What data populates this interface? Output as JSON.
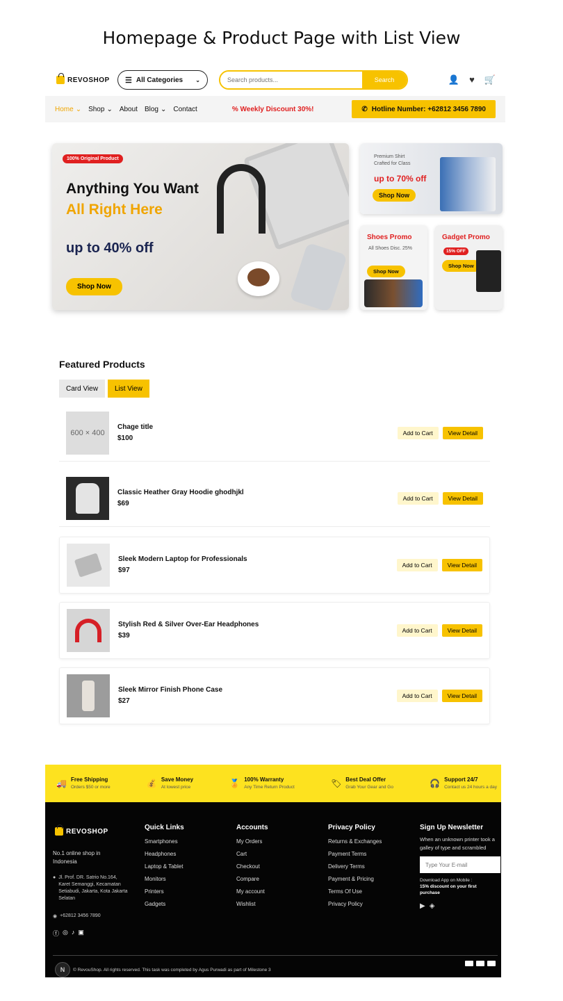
{
  "page_title": "Homepage & Product Page with List View",
  "header": {
    "logo": "REVOSHOP",
    "categories_label": "All Categories",
    "search_placeholder": "Search products...",
    "search_button": "Search"
  },
  "nav": {
    "items": [
      "Home",
      "Shop",
      "About",
      "Blog",
      "Contact"
    ],
    "discount": "Weekly Discount 30%!",
    "hotline": "Hotline Number: +62812 3456 7890"
  },
  "hero": {
    "badge": "100% Original Product",
    "line1": "Anything You Want",
    "line2": "All Right Here",
    "line3": "up to 40% off",
    "button": "Shop Now"
  },
  "promos": {
    "shirt": {
      "text1": "Premium Shirt",
      "text2": "Crafted for Class",
      "headline": "up to 70% off",
      "button": "Shop Now"
    },
    "shoes": {
      "title": "Shoes Promo",
      "text": "All Shoes Disc. 25%",
      "button": "Shop Now"
    },
    "gadget": {
      "title": "Gadget Promo",
      "badge": "15% OFF",
      "button": "Shop Now"
    }
  },
  "featured": {
    "title": "Featured Products",
    "card_view": "Card View",
    "list_view": "List View",
    "add_to_cart": "Add to Cart",
    "view_detail": "View Detail",
    "products": [
      {
        "name": "Chage title",
        "price": "$100",
        "thumb": "600 × 400"
      },
      {
        "name": "Classic Heather Gray Hoodie ghodhjkl",
        "price": "$69",
        "thumb": ""
      },
      {
        "name": "Sleek Modern Laptop for Professionals",
        "price": "$97",
        "thumb": ""
      },
      {
        "name": "Stylish Red & Silver Over-Ear Headphones",
        "price": "$39",
        "thumb": ""
      },
      {
        "name": "Sleek Mirror Finish Phone Case",
        "price": "$27",
        "thumb": ""
      }
    ]
  },
  "features": [
    {
      "title": "Free Shipping",
      "sub": "Orders $50 or more"
    },
    {
      "title": "Save Money",
      "sub": "At lowest price"
    },
    {
      "title": "100% Warranty",
      "sub": "Any Time Return Product"
    },
    {
      "title": "Best Deal Offer",
      "sub": "Grab Your Gear and Go"
    },
    {
      "title": "Support 24/7",
      "sub": "Contact us 24 hours a day"
    }
  ],
  "footer": {
    "logo": "REVOSHOP",
    "tagline": "No.1 online shop in Indonesia",
    "address": "Jl. Prof. DR. Satrio No.164, Karet Semanggi, Kecamatan Setiabudi, Jakarta, Kota Jakarta Selatan",
    "phone": "+62812 3456 7890",
    "quick_links": {
      "title": "Quick Links",
      "items": [
        "Smartphones",
        "Headphones",
        "Laptop & Tablet",
        "Monitors",
        "Printers",
        "Gadgets"
      ]
    },
    "accounts": {
      "title": "Accounts",
      "items": [
        "My Orders",
        "Cart",
        "Checkout",
        "Compare",
        "My account",
        "Wishlist"
      ]
    },
    "privacy": {
      "title": "Privacy Policy",
      "items": [
        "Returns & Exchanges",
        "Payment Terms",
        "Delivery Terms",
        "Payment & Pricing",
        "Terms Of Use",
        "Privacy Policy"
      ]
    },
    "newsletter": {
      "title": "Sign Up Newsletter",
      "text": "When an unknown printer took a galley of type and scrambled",
      "placeholder": "Type Your E-mail",
      "app_text": "Download App on Mobile :",
      "app_bold": "15% discount on your first purchase"
    },
    "copyright": "© RevouShop. All rights reserved. This task was completed by Agus Purwadi as part of Milestone 3",
    "n_badge": "N"
  },
  "colors": {
    "accent": "#f7c200",
    "sale": "#e02020",
    "dark": "#050505"
  }
}
